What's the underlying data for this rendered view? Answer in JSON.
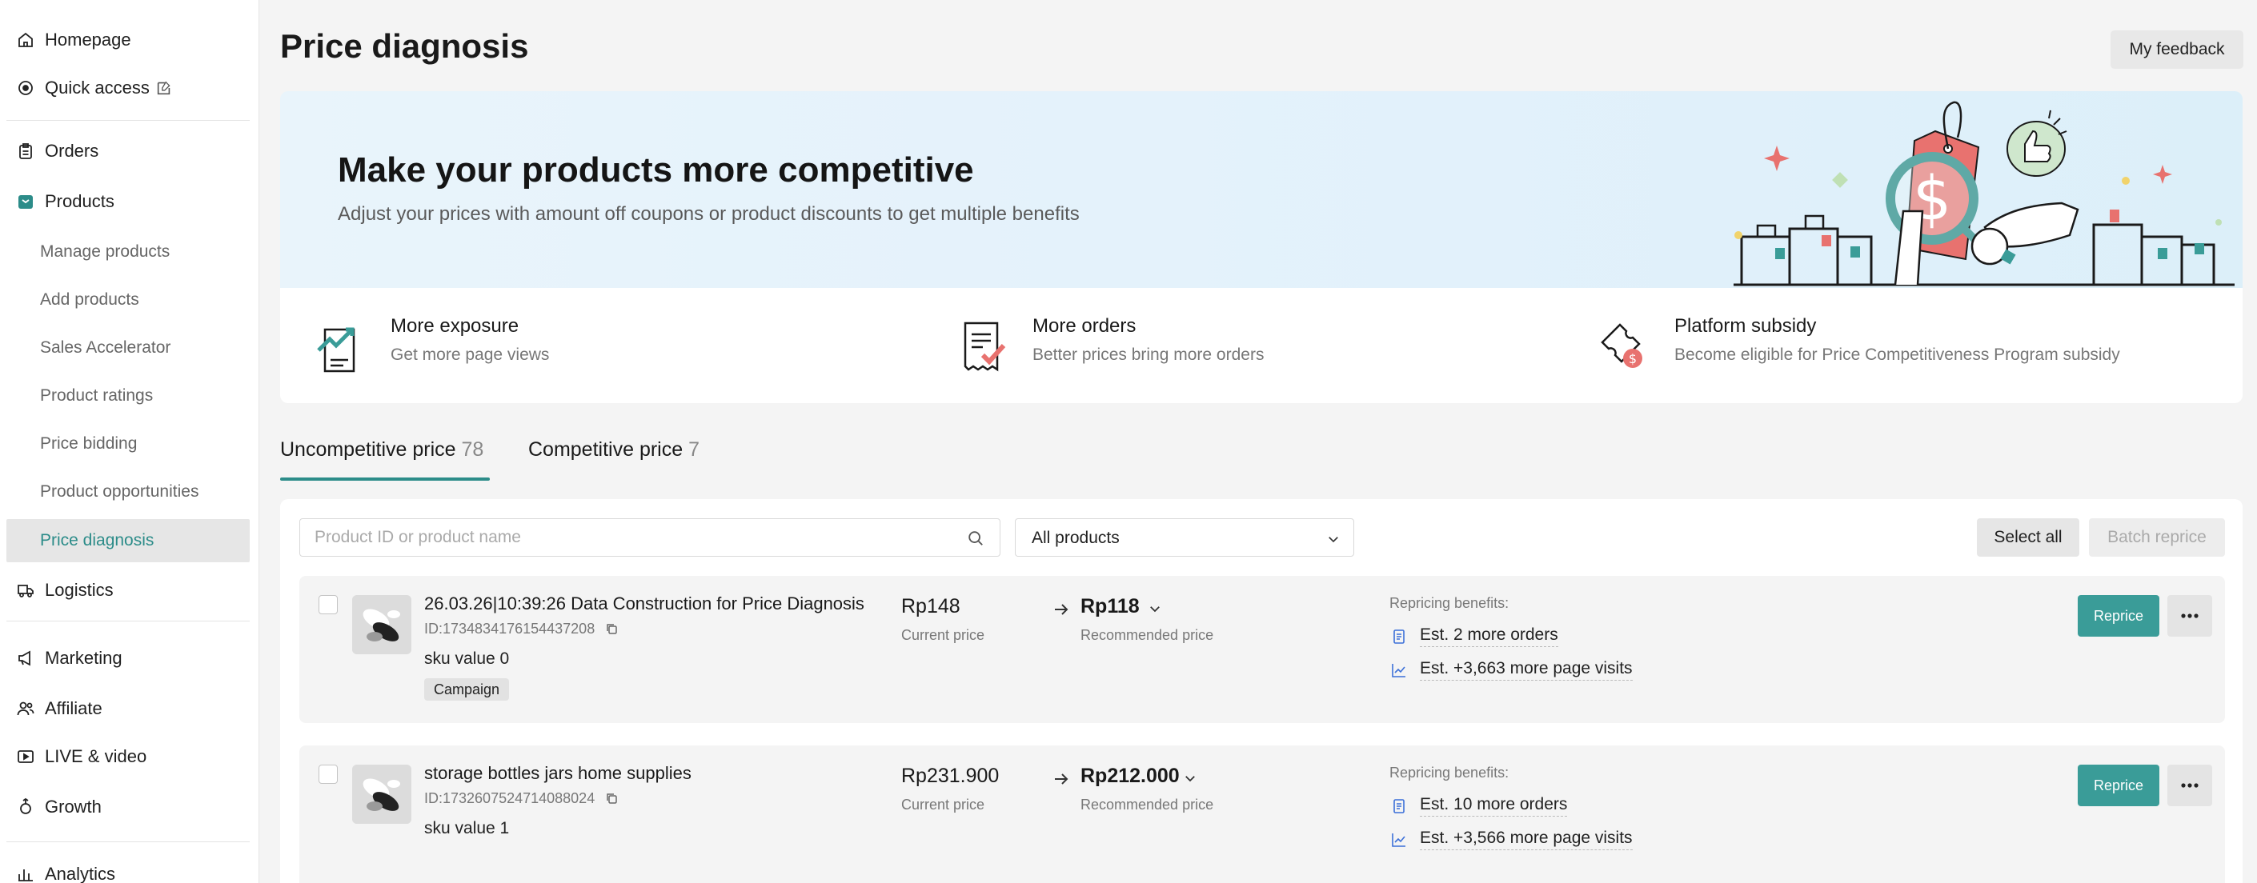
{
  "sidebar": {
    "items": [
      {
        "label": "Homepage",
        "icon": "home-icon"
      },
      {
        "label": "Quick access",
        "icon": "quick-access-icon"
      },
      {
        "label": "Orders",
        "icon": "clipboard-icon"
      },
      {
        "label": "Products",
        "icon": "products-icon"
      },
      {
        "label": "Logistics",
        "icon": "truck-icon"
      },
      {
        "label": "Marketing",
        "icon": "megaphone-icon"
      },
      {
        "label": "Affiliate",
        "icon": "affiliate-icon"
      },
      {
        "label": "LIVE & video",
        "icon": "video-icon"
      },
      {
        "label": "Growth",
        "icon": "growth-icon"
      },
      {
        "label": "Analytics",
        "icon": "analytics-icon"
      }
    ],
    "products_sub": [
      "Manage products",
      "Add products",
      "Sales Accelerator",
      "Product ratings",
      "Price bidding",
      "Product opportunities",
      "Price diagnosis"
    ],
    "active_sub": "Price diagnosis"
  },
  "header": {
    "title": "Price diagnosis",
    "feedback_label": "My feedback"
  },
  "banner": {
    "title": "Make your products more competitive",
    "subtitle": "Adjust your prices with amount off coupons or product discounts to get multiple benefits"
  },
  "benefits": [
    {
      "title": "More exposure",
      "desc": "Get more page views",
      "icon": "exposure-chart-icon"
    },
    {
      "title": "More orders",
      "desc": "Better prices bring more orders",
      "icon": "receipt-check-icon"
    },
    {
      "title": "Platform subsidy",
      "desc": "Become eligible for Price Competitiveness Program subsidy",
      "icon": "subsidy-ticket-icon"
    }
  ],
  "tabs": [
    {
      "label": "Uncompetitive price",
      "count": "78",
      "active": true
    },
    {
      "label": "Competitive price",
      "count": "7",
      "active": false
    }
  ],
  "filters": {
    "search_placeholder": "Product ID or product name",
    "select_value": "All products",
    "select_all_label": "Select all",
    "batch_reprice_label": "Batch reprice"
  },
  "products": [
    {
      "name": "26.03.26|10:39:26 Data Construction for Price Diagnosis",
      "id": "ID:1734834176154437208",
      "sku": "sku value 0",
      "tag": "Campaign",
      "current_price": "Rp148",
      "current_label": "Current price",
      "recommended_price": "Rp118",
      "recommended_label": "Recommended price",
      "benefits_title": "Repricing benefits:",
      "benefit_orders": "Est. 2 more orders",
      "benefit_visits": "Est. +3,663 more page visits",
      "reprice_label": "Reprice"
    },
    {
      "name": "storage bottles jars home supplies",
      "id": "ID:1732607524714088024",
      "sku": "sku value 1",
      "tag": "",
      "current_price": "Rp231.900",
      "current_label": "Current price",
      "recommended_price": "Rp212.000",
      "recommended_label": "Recommended price",
      "benefits_title": "Repricing benefits:",
      "benefit_orders": "Est. 10 more orders",
      "benefit_visits": "Est. +3,566 more page visits",
      "reprice_label": "Reprice"
    }
  ],
  "colors": {
    "accent": "#2c8c89",
    "button_primary": "#3a9c98",
    "banner_bg": "#e6f3fb",
    "price_tag": "#e8726f"
  }
}
